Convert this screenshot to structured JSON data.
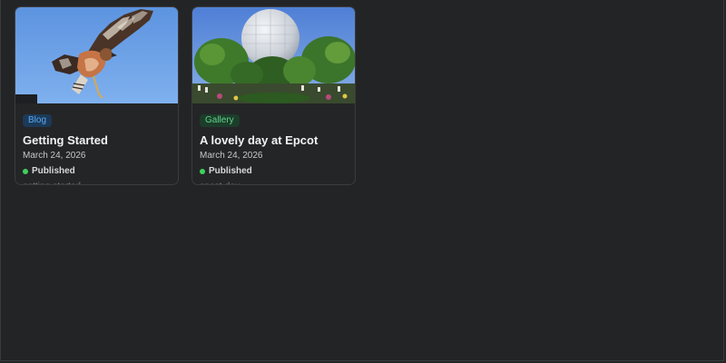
{
  "cards": [
    {
      "category": "Blog",
      "title": "Getting Started",
      "date": "March 24, 2026",
      "status": "Published",
      "slug": "getting-started"
    },
    {
      "category": "Gallery",
      "title": "A lovely day at Epcot",
      "date": "March 24, 2026",
      "status": "Published",
      "slug": "epcot-day"
    }
  ],
  "colors": {
    "background": "#232425",
    "blog_badge": "#58a8f5",
    "gallery_badge": "#5fd48a",
    "published_dot": "#3fd15a"
  }
}
